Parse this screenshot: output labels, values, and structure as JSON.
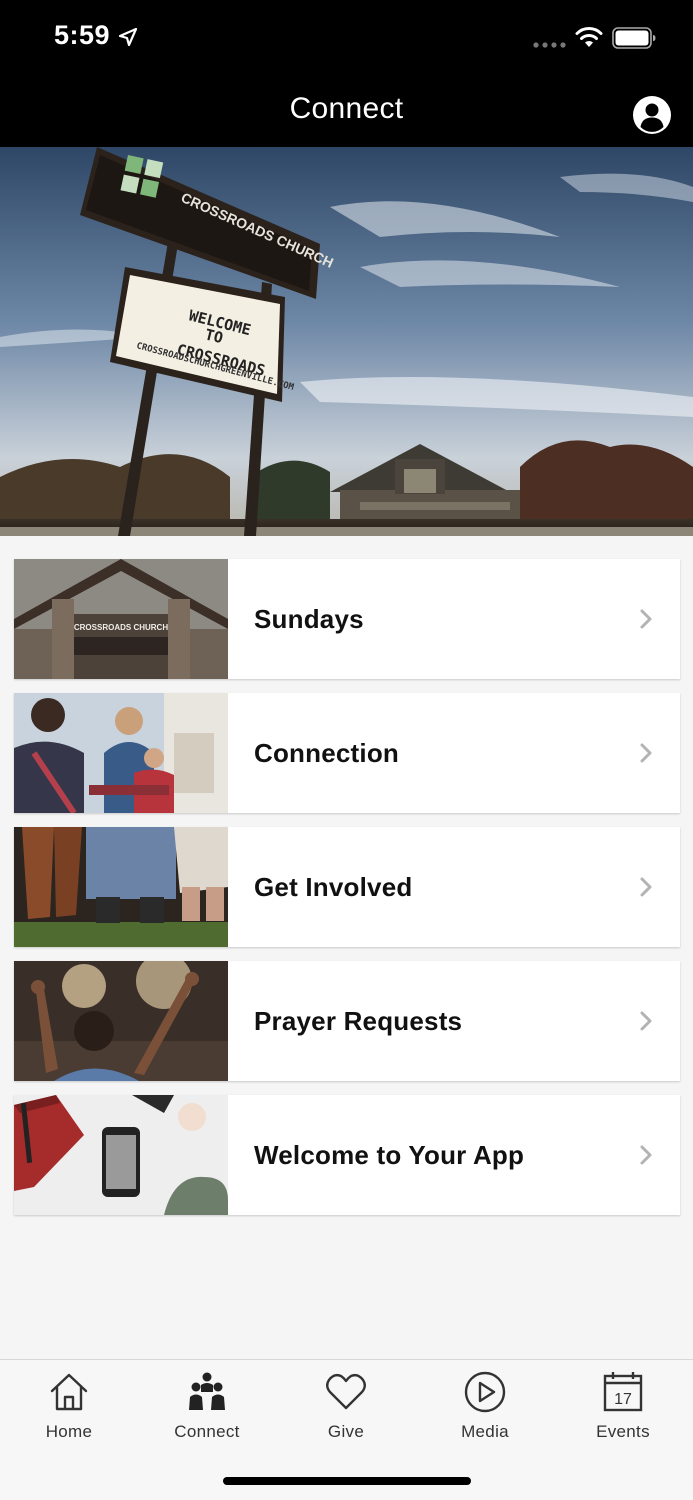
{
  "status_bar": {
    "time": "5:59"
  },
  "nav": {
    "title": "Connect"
  },
  "hero": {
    "sign_brand": "CROSSROADS CHURCH",
    "sign_line1": "WELCOME",
    "sign_line2": "TO",
    "sign_line3": "CROSSROADS",
    "sign_url": "CROSSROADSCHURCHGREENVILLE.COM"
  },
  "menu": {
    "items": [
      {
        "label": "Sundays",
        "thumb_text": "CROSSROADS CHURCH"
      },
      {
        "label": "Connection"
      },
      {
        "label": "Get Involved"
      },
      {
        "label": "Prayer Requests"
      },
      {
        "label": "Welcome to Your App"
      }
    ]
  },
  "tabs": [
    {
      "label": "Home",
      "icon": "home-icon"
    },
    {
      "label": "Connect",
      "icon": "people-icon"
    },
    {
      "label": "Give",
      "icon": "heart-icon"
    },
    {
      "label": "Media",
      "icon": "play-circle-icon"
    },
    {
      "label": "Events",
      "icon": "calendar-icon",
      "day": "17"
    }
  ],
  "colors": {
    "nav_background": "#000000",
    "page_background": "#f5f5f5",
    "card_background": "#ffffff",
    "chevron": "#b3b3b3"
  }
}
